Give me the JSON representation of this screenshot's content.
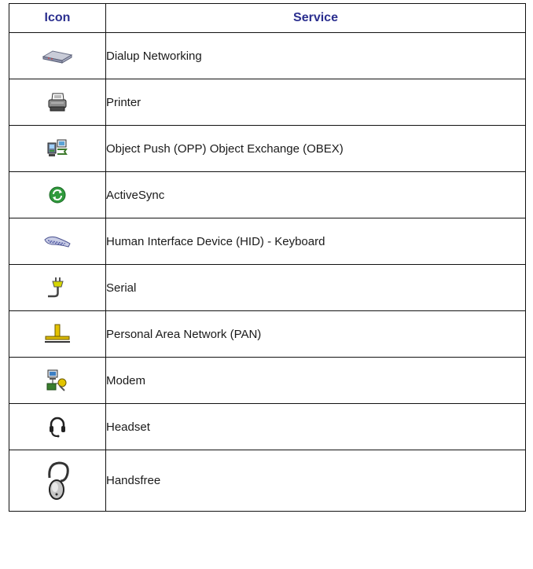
{
  "table": {
    "header": {
      "icon": "Icon",
      "service": "Service"
    },
    "rows": [
      {
        "icon": "dialup-networking-icon",
        "service": "Dialup Networking"
      },
      {
        "icon": "printer-icon",
        "service": "Printer"
      },
      {
        "icon": "object-push-icon",
        "service": "Object Push (OPP) Object Exchange (OBEX)"
      },
      {
        "icon": "activesync-icon",
        "service": "ActiveSync"
      },
      {
        "icon": "keyboard-icon",
        "service": "Human Interface Device (HID) - Keyboard"
      },
      {
        "icon": "serial-plug-icon",
        "service": "Serial"
      },
      {
        "icon": "network-pan-icon",
        "service": "Personal Area Network (PAN)"
      },
      {
        "icon": "modem-icon",
        "service": "Modem"
      },
      {
        "icon": "headset-icon",
        "service": "Headset"
      },
      {
        "icon": "handsfree-earpiece-icon",
        "service": "Handsfree"
      }
    ]
  },
  "colors": {
    "header_text": "#2b2f8f",
    "border": "#111111"
  }
}
